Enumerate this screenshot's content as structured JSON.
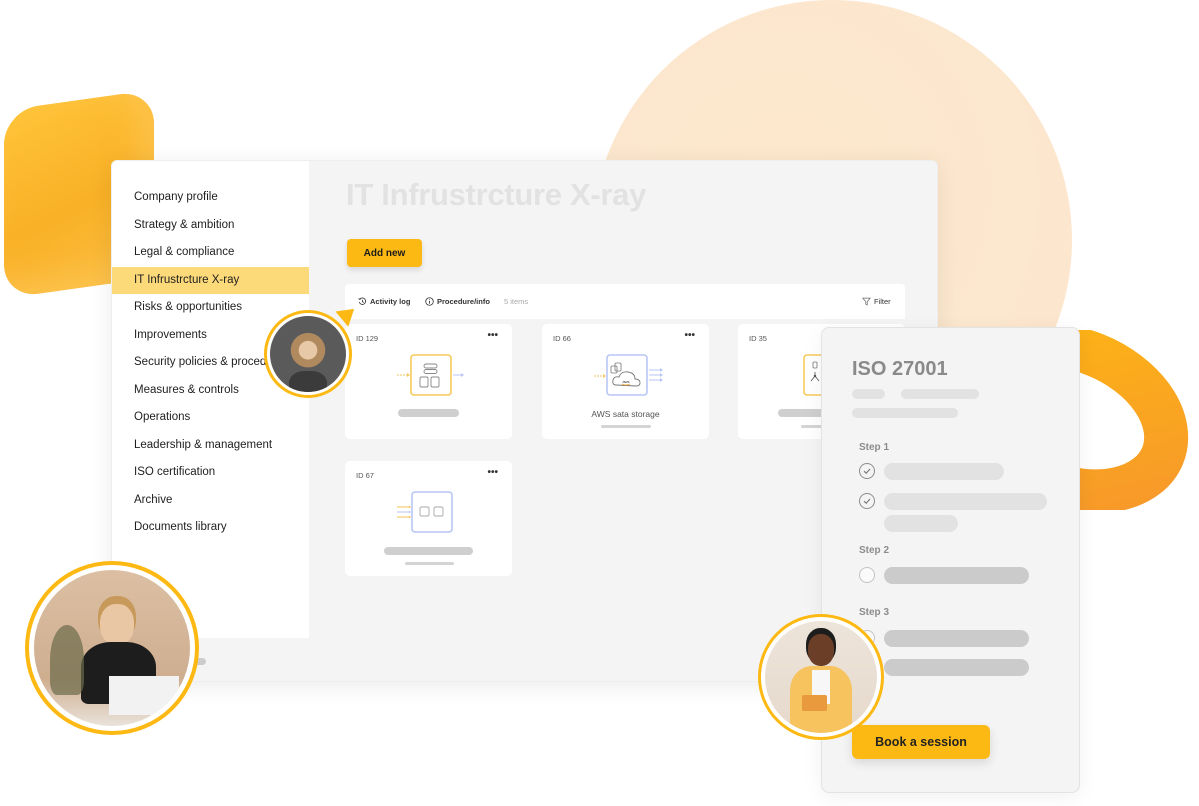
{
  "sidebar": {
    "items": [
      {
        "label": "Company profile",
        "active": false
      },
      {
        "label": "Strategy & ambition",
        "active": false
      },
      {
        "label": "Legal & compliance",
        "active": false
      },
      {
        "label": "IT Infrustrcture X-ray",
        "active": true
      },
      {
        "label": "Risks & opportunities",
        "active": false
      },
      {
        "label": "Improvements",
        "active": false
      },
      {
        "label": "Security policies & procedures",
        "active": false
      },
      {
        "label": "Measures & controls",
        "active": false
      },
      {
        "label": "Operations",
        "active": false
      },
      {
        "label": "Leadership & management",
        "active": false
      },
      {
        "label": "ISO certification",
        "active": false
      },
      {
        "label": "Archive",
        "active": false
      },
      {
        "label": "Documents library",
        "active": false
      }
    ]
  },
  "main": {
    "title": "IT Infrustrcture X-ray",
    "add_button": "Add new",
    "toolbar": {
      "activity_log": "Activity log",
      "procedure_info": "Procedure/info",
      "item_count": "5 items",
      "filter": "Filter"
    },
    "cards": [
      {
        "id": "ID 129",
        "name": "",
        "menu": "•••",
        "icon": "server-documents-icon"
      },
      {
        "id": "ID 66",
        "name": "AWS sata storage",
        "menu": "•••",
        "icon": "aws-cloud-storage-icon"
      },
      {
        "id": "ID 35",
        "name": "",
        "menu": "•••",
        "icon": "network-node-icon"
      },
      {
        "id": "ID 67",
        "name": "",
        "menu": "•••",
        "icon": "module-blocks-icon"
      }
    ]
  },
  "iso_panel": {
    "title": "ISO 27001",
    "steps": [
      {
        "label": "Step 1",
        "tasks_done": 2,
        "tasks_total": 2
      },
      {
        "label": "Step 2",
        "tasks_done": 0,
        "tasks_total": 1
      },
      {
        "label": "Step 3",
        "tasks_done": 0,
        "tasks_total": 2
      }
    ],
    "book_button": "Book a session"
  },
  "colors": {
    "accent": "#fdb913",
    "sidebar_active": "#fcd979",
    "background_circle": "#fde8cc",
    "ring": "#f9a825"
  }
}
